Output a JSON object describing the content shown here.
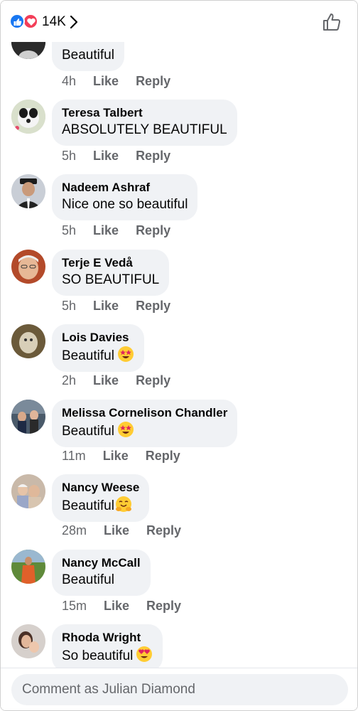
{
  "header": {
    "reaction_count": "14K"
  },
  "comments": [
    {
      "name": "",
      "text": "Beautiful",
      "time": "4h"
    },
    {
      "name": "Teresa Talbert",
      "text": "ABSOLUTELY BEAUTIFUL",
      "time": "5h"
    },
    {
      "name": "Nadeem Ashraf",
      "text": "Nice one  so beautiful",
      "time": "5h"
    },
    {
      "name": "Terje E Vedå",
      "text": "SO BEAUTIFUL",
      "time": "5h"
    },
    {
      "name": "Lois Davies",
      "text": "Beautiful",
      "time": "2h",
      "emoji": "star-struck"
    },
    {
      "name": "Melissa Cornelison Chandler",
      "text": "Beautiful",
      "time": "11m",
      "emoji": "star-struck"
    },
    {
      "name": "Nancy Weese",
      "text": "Beautiful",
      "time": "28m",
      "emoji": "hugging-face"
    },
    {
      "name": "Nancy McCall",
      "text": "Beautiful",
      "time": "15m"
    },
    {
      "name": "Rhoda Wright",
      "text": "So beautiful",
      "time": "",
      "emoji": "heart-eyes"
    }
  ],
  "actions": {
    "like": "Like",
    "reply": "Reply"
  },
  "composer": {
    "placeholder": "Comment as Julian Diamond"
  },
  "colors": {
    "bubble": "#f0f2f5",
    "meta": "#65676b",
    "like_blue": "#1877f2",
    "love_red": "#f33e58"
  }
}
